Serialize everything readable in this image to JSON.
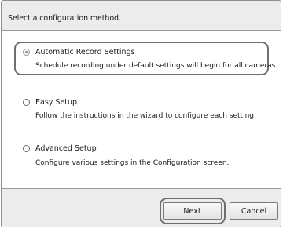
{
  "prompt": "Select a configuration method.",
  "options": [
    {
      "title": "Automatic Record Settings",
      "description": "Schedule recording under default settings will begin for all cameras.",
      "selected": true
    },
    {
      "title": "Easy Setup",
      "description": "Follow the instructions in the wizard to configure each setting.",
      "selected": false
    },
    {
      "title": "Advanced Setup",
      "description": "Configure various settings in the Configuration screen.",
      "selected": false
    }
  ],
  "buttons": {
    "next": "Next",
    "cancel": "Cancel"
  }
}
